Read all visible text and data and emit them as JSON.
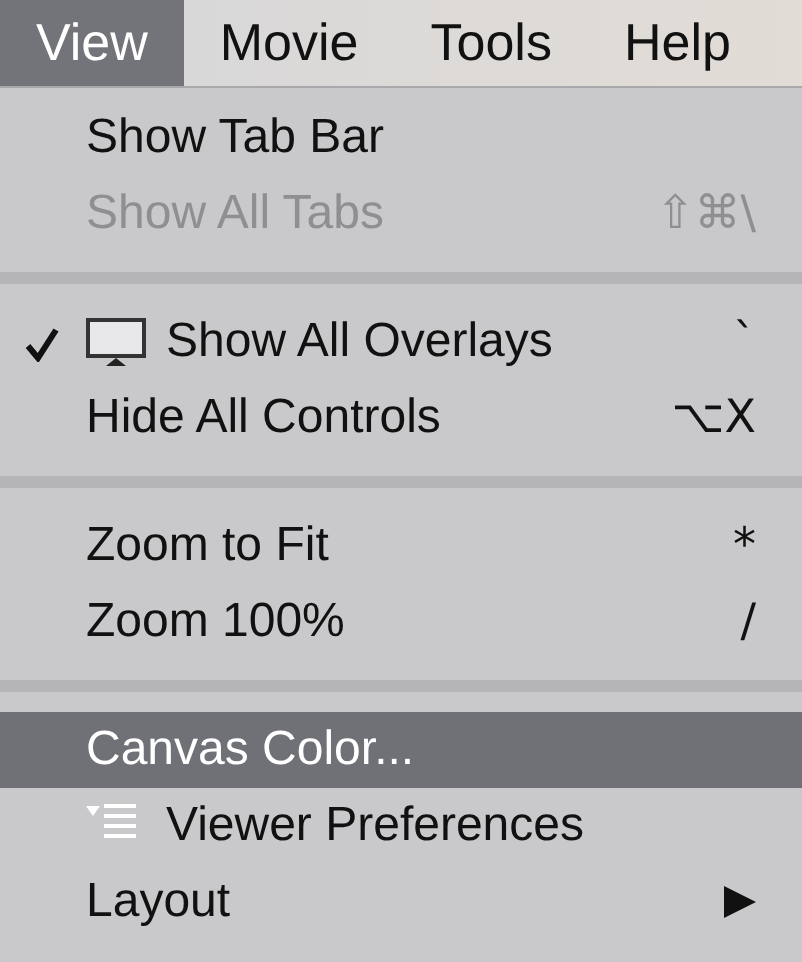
{
  "menubar": [
    {
      "label": "View",
      "selected": true
    },
    {
      "label": "Movie",
      "selected": false
    },
    {
      "label": "Tools",
      "selected": false
    },
    {
      "label": "Help",
      "selected": false
    }
  ],
  "menu": [
    {
      "kind": "item",
      "label": "Show Tab Bar",
      "disabled": false,
      "checked": false,
      "selected": false
    },
    {
      "kind": "item",
      "label": "Show All Tabs",
      "shortcut": "⇧⌘\\",
      "disabled": true,
      "checked": false,
      "selected": false
    },
    {
      "kind": "separator"
    },
    {
      "kind": "monitor_item",
      "label": "Show All Overlays",
      "shortcut": "`",
      "disabled": false,
      "checked": true,
      "selected": false
    },
    {
      "kind": "item",
      "label": "Hide All Controls",
      "shortcut": "⌥X",
      "disabled": false,
      "checked": false,
      "selected": false
    },
    {
      "kind": "separator"
    },
    {
      "kind": "item",
      "label": "Zoom to Fit",
      "shortcut": "*",
      "disabled": false,
      "checked": false,
      "selected": false
    },
    {
      "kind": "item",
      "label": "Zoom 100%",
      "shortcut": "/",
      "disabled": false,
      "checked": false,
      "selected": false
    },
    {
      "kind": "separator"
    },
    {
      "kind": "item",
      "label": "Canvas Color...",
      "disabled": false,
      "checked": false,
      "selected": true
    },
    {
      "kind": "prefs_item",
      "label": "Viewer Preferences",
      "disabled": false,
      "checked": false,
      "selected": false
    },
    {
      "kind": "submenu",
      "label": "Layout",
      "disabled": false,
      "checked": false,
      "selected": false
    }
  ]
}
